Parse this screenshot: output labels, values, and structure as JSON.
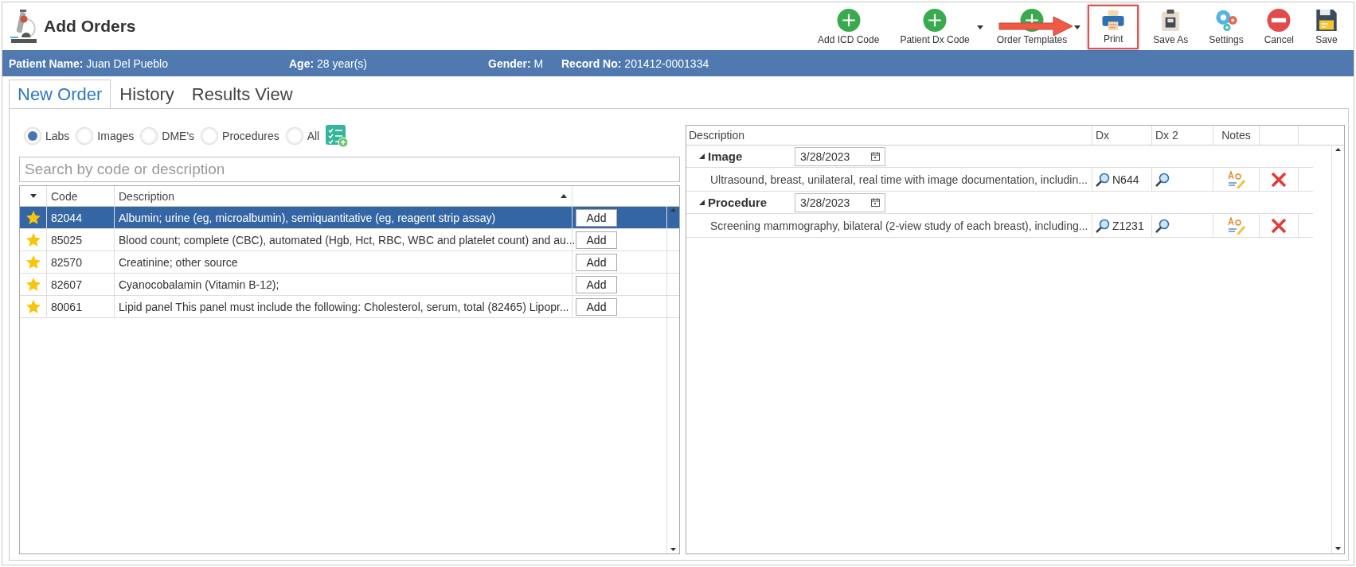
{
  "window": {
    "title": "Add Orders"
  },
  "toolbar": [
    {
      "label": "Add ICD Code",
      "kind": "add",
      "highlighted": false,
      "dropdown": false
    },
    {
      "label": "Patient Dx Code",
      "kind": "add",
      "highlighted": false,
      "dropdown": true
    },
    {
      "label": "Order Templates",
      "kind": "add",
      "highlighted": false,
      "dropdown": true
    },
    {
      "label": "Print",
      "kind": "print",
      "highlighted": true,
      "dropdown": false
    },
    {
      "label": "Save As",
      "kind": "saveas",
      "highlighted": false,
      "dropdown": false
    },
    {
      "label": "Settings",
      "kind": "settings",
      "highlighted": false,
      "dropdown": false
    },
    {
      "label": "Cancel",
      "kind": "cancel",
      "highlighted": false,
      "dropdown": false
    },
    {
      "label": "Save",
      "kind": "save",
      "highlighted": false,
      "dropdown": false
    }
  ],
  "patient_bar": [
    {
      "label": "Patient Name:",
      "value": "Juan Del Pueblo"
    },
    {
      "label": "Age:",
      "value": "28 year(s)"
    },
    {
      "label": "Gender:",
      "value": "M"
    },
    {
      "label": "Record No:",
      "value": "201412-0001334"
    }
  ],
  "tabs": [
    {
      "label": "New Order",
      "selected": true
    },
    {
      "label": "History",
      "selected": false
    },
    {
      "label": "Results View",
      "selected": false
    }
  ],
  "filters": [
    {
      "label": "Labs",
      "selected": true
    },
    {
      "label": "Images",
      "selected": false
    },
    {
      "label": "DME's",
      "selected": false
    },
    {
      "label": "Procedures",
      "selected": false
    },
    {
      "label": "All",
      "selected": false
    }
  ],
  "search": {
    "placeholder": "Search by code or description"
  },
  "codes_table": {
    "columns": [
      "Code",
      "Description"
    ],
    "rows": [
      {
        "favorite": true,
        "code": "82044",
        "description": "Albumin; urine (eg, microalbumin), semiquantitative (eg, reagent strip assay)",
        "action": "Add",
        "selected": true
      },
      {
        "favorite": true,
        "code": "85025",
        "description": "Blood count; complete (CBC), automated (Hgb, Hct, RBC, WBC and platelet count) and au...",
        "action": "Add",
        "selected": false
      },
      {
        "favorite": true,
        "code": "82570",
        "description": "Creatinine; other source",
        "action": "Add",
        "selected": false
      },
      {
        "favorite": true,
        "code": "82607",
        "description": "Cyanocobalamin (Vitamin B-12);",
        "action": "Add",
        "selected": false
      },
      {
        "favorite": true,
        "code": "80061",
        "description": "Lipid panel This panel must include the following: Cholesterol, serum, total (82465) Lipopr...",
        "action": "Add",
        "selected": false
      }
    ]
  },
  "orders_table": {
    "columns": [
      "Description",
      "Dx",
      "Dx 2",
      "Notes"
    ],
    "groups": [
      {
        "name": "Image",
        "date": "3/28/2023",
        "expanded": true,
        "items": [
          {
            "description": "Ultrasound, breast, unilateral, real time with image documentation, includin...",
            "dx": "N644"
          }
        ]
      },
      {
        "name": "Procedure",
        "date": "3/28/2023",
        "expanded": true,
        "items": [
          {
            "description": "Screening mammography, bilateral (2-view study of each breast), including...",
            "dx": "Z1231"
          }
        ]
      }
    ]
  }
}
